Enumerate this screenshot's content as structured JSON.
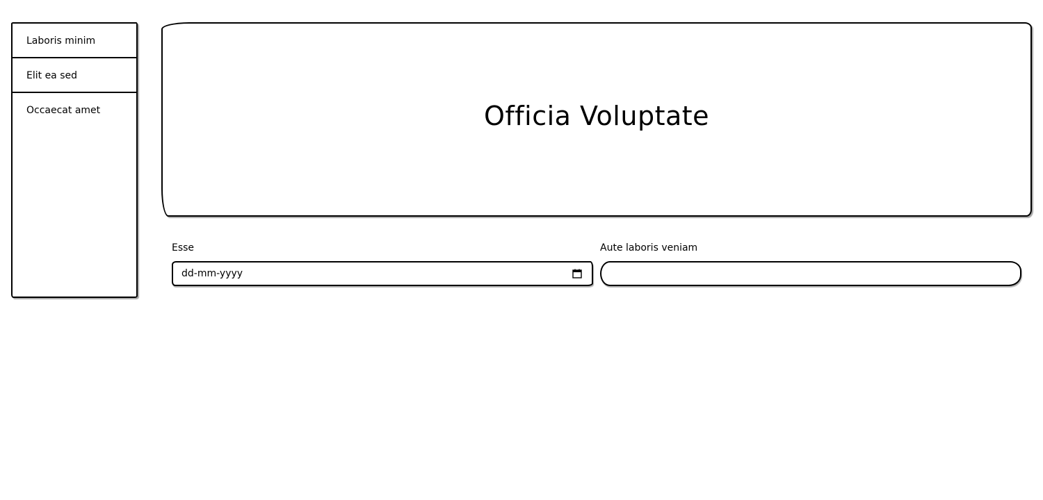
{
  "sidebar": {
    "items": [
      {
        "label": "Laboris minim"
      },
      {
        "label": "Elit ea sed"
      },
      {
        "label": "Occaecat amet"
      }
    ]
  },
  "hero": {
    "title": "Officia Voluptate"
  },
  "form": {
    "esse": {
      "label": "Esse",
      "placeholder": "dd-mm-yyyy",
      "icon": "calendar-icon"
    },
    "aute": {
      "label": "Aute laboris veniam",
      "value": ""
    }
  }
}
